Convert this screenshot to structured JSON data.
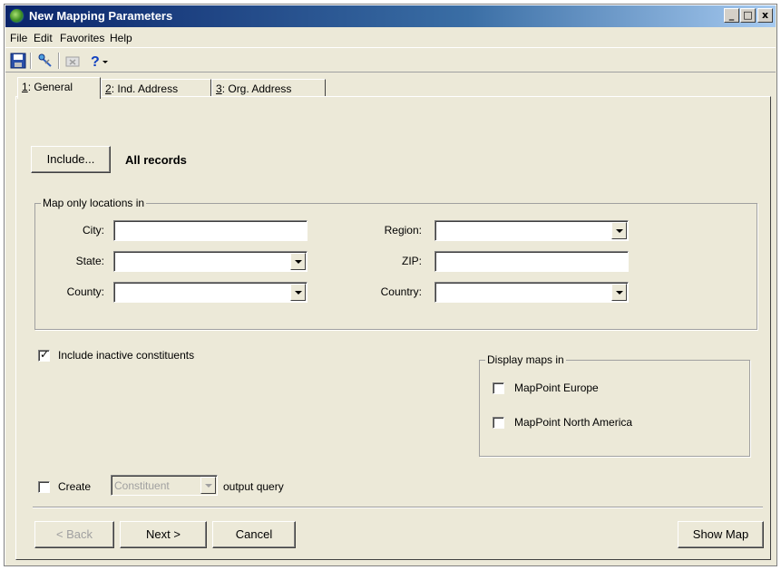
{
  "window": {
    "title": "New Mapping Parameters",
    "title_icon": "mapping-globe-icon",
    "controls": {
      "minimize": "_",
      "maximize": "□",
      "close": "x"
    }
  },
  "menu": [
    "File",
    "Edit",
    "Favorites",
    "Help"
  ],
  "toolbar": {
    "icons": [
      "save-icon",
      "pin-icon",
      "delete-icon",
      "help-icon",
      "dropdown-arrow-icon"
    ]
  },
  "tabs": [
    {
      "key": "1",
      "rest": ": General",
      "active": true
    },
    {
      "key": "2",
      "rest": ": Ind. Address",
      "active": false
    },
    {
      "key": "3",
      "rest": ": Org. Address",
      "active": false
    }
  ],
  "include": {
    "button_label": "Include...",
    "value": "All records"
  },
  "locations": {
    "legend": "Map only locations in",
    "city": {
      "label": "City:",
      "value": ""
    },
    "state": {
      "label": "State:",
      "value": ""
    },
    "county": {
      "label": "County:",
      "value": ""
    },
    "region": {
      "label": "Region:",
      "value": ""
    },
    "zip": {
      "label": "ZIP:",
      "value": ""
    },
    "country": {
      "label": "Country:",
      "value": ""
    }
  },
  "include_inactive": {
    "label": "Include inactive constituents",
    "checked": true
  },
  "display_maps": {
    "legend": "Display maps in",
    "europe": {
      "label": "MapPoint Europe",
      "checked": false
    },
    "north_america": {
      "label": "MapPoint North America",
      "checked": false
    }
  },
  "create_query": {
    "label_before": "Create",
    "select_value": "Constituent",
    "label_after": "output query",
    "checked": false
  },
  "footer": {
    "back": "< Back",
    "next": "Next >",
    "cancel": "Cancel",
    "show_map": "Show Map"
  },
  "colors": {
    "face": "#ece9d8",
    "title_start": "#0a246a",
    "title_end": "#a6caf0"
  }
}
